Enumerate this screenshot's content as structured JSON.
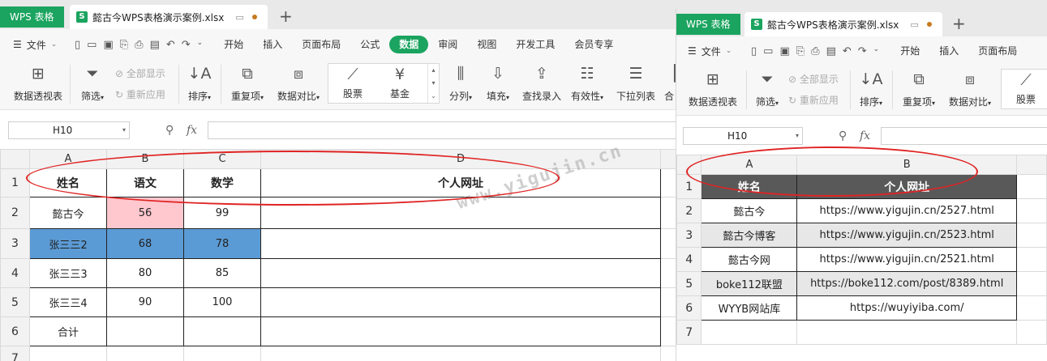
{
  "brand": "WPS 表格",
  "doc_tab": {
    "icon": "S",
    "filename": "懿古今WPS表格演示案例.xlsx"
  },
  "menu": {
    "file": "文件",
    "items": [
      "开始",
      "插入",
      "页面布局",
      "公式",
      "数据",
      "审阅",
      "视图",
      "开发工具",
      "会员专享"
    ],
    "active": "数据"
  },
  "ribbon": {
    "pivot": "数据透视表",
    "filter": "筛选",
    "show_all": "全部显示",
    "reapply": "重新应用",
    "sort": "排序",
    "dupes": "重复项",
    "compare": "数据对比",
    "stock": "股票",
    "fund": "基金",
    "split": "分列",
    "fill": "填充",
    "lookup": "查找录入",
    "validity": "有效性",
    "dropdown": "下拉列表",
    "merge": "合"
  },
  "formula": {
    "namebox": "H10",
    "fx": "fx"
  },
  "left_sheet": {
    "col_headers": [
      "A",
      "B",
      "C",
      "D"
    ],
    "row_headers": [
      "1",
      "2",
      "3",
      "4",
      "5",
      "6",
      "7"
    ],
    "header_row": [
      "姓名",
      "语文",
      "数学",
      "个人网址"
    ],
    "rows": [
      [
        "懿古今",
        "56",
        "99",
        ""
      ],
      [
        "张三三2",
        "68",
        "78",
        ""
      ],
      [
        "张三三3",
        "80",
        "85",
        ""
      ],
      [
        "张三三4",
        "90",
        "100",
        ""
      ],
      [
        "合计",
        "",
        "",
        ""
      ]
    ]
  },
  "right_sheet": {
    "col_headers": [
      "A",
      "B"
    ],
    "row_headers": [
      "1",
      "2",
      "3",
      "4",
      "5",
      "6",
      "7"
    ],
    "header_row": [
      "姓名",
      "个人网址"
    ],
    "rows": [
      [
        "懿古今",
        "https://www.yigujin.cn/2527.html"
      ],
      [
        "懿古今博客",
        "https://www.yigujin.cn/2523.html"
      ],
      [
        "懿古今网",
        "https://www.yigujin.cn/2521.html"
      ],
      [
        "boke112联盟",
        "https://boke112.com/post/8389.html"
      ],
      [
        "WYYB网站库",
        "https://wuyiyiba.com/"
      ]
    ]
  },
  "watermark": "www.yigujin.cn",
  "colors": {
    "brand_green": "#1ba45f",
    "ellipse_red": "#e02424",
    "pink_fill": "#ffc7ce",
    "blue_fill": "#5b9bd5",
    "dark_header": "#595959"
  }
}
